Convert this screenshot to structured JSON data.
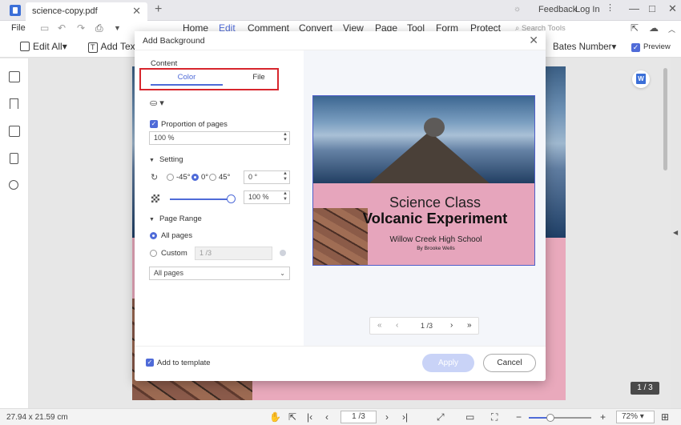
{
  "tabbar": {
    "doc_name": "science-copy.pdf",
    "close_glyph": "✕",
    "new_tab_glyph": "+",
    "feedback": "Feedback",
    "login": "Log In"
  },
  "menubar": {
    "file": "File",
    "items": [
      "Home",
      "Edit",
      "Comment",
      "Convert",
      "View",
      "Page",
      "Tool",
      "Form",
      "Protect"
    ],
    "active": "Edit",
    "search_tools": "Search Tools"
  },
  "toolbar": {
    "edit_all": "Edit All",
    "add_text": "Add Text",
    "bates_number": "Bates Number",
    "preview": "Preview"
  },
  "dialog": {
    "title": "Add Background",
    "content_label": "Content",
    "tab_color": "Color",
    "tab_file": "File",
    "proportion_label": "Proportion of pages",
    "proportion_value": "100 %",
    "setting_label": "Setting",
    "rotation_options": [
      "-45°",
      "0°",
      "45°"
    ],
    "rotation_selected": "0°",
    "rotation_value": "0 °",
    "opacity_value": "100 %",
    "page_range_label": "Page Range",
    "all_pages": "All pages",
    "custom": "Custom",
    "custom_value": "1 /3",
    "pages_select": "All pages",
    "add_to_template": "Add to template",
    "apply": "Apply",
    "cancel": "Cancel"
  },
  "preview": {
    "line1": "Science Class",
    "line2": "Volcanic Experiment",
    "line3": "Willow Creek High School",
    "line4": "By Brooke Wells",
    "pager_value": "1 /3"
  },
  "status": {
    "page_size": "27.94 x 21.59 cm",
    "page_input": "1 /3",
    "zoom": "72%",
    "page_counter": "1 / 3"
  },
  "colors": {
    "accent": "#4f6bd8",
    "highlight_box": "#d7262d",
    "preview_pink": "#e6a5bc"
  }
}
